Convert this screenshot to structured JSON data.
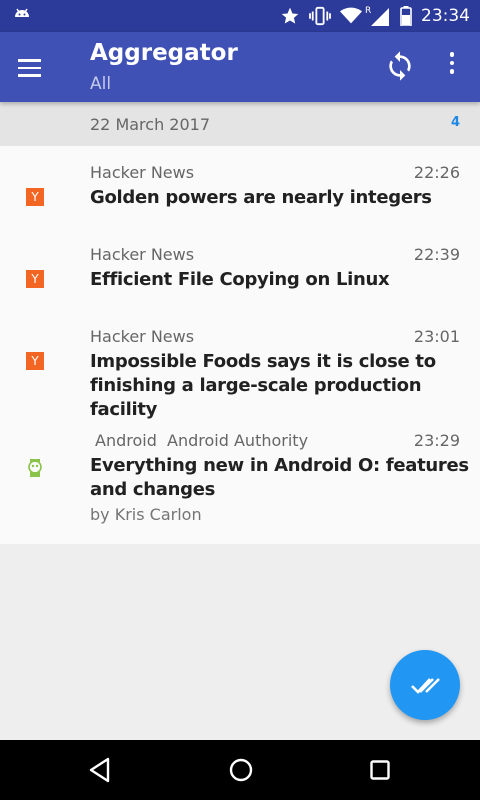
{
  "status_bar": {
    "time": "23:34",
    "icons": [
      "android-icon",
      "star-icon",
      "vibrate-icon",
      "wifi-icon",
      "signal-icon",
      "battery-icon"
    ],
    "signal_label": "R"
  },
  "app_bar": {
    "title": "Aggregator",
    "subtitle": "All",
    "icons": [
      "menu-icon",
      "refresh-icon",
      "overflow-menu-icon"
    ]
  },
  "date_group": {
    "date": "22 March 2017",
    "count": "4"
  },
  "items": [
    {
      "source_icon_letter": "Y",
      "source": "Hacker News",
      "time": "22:26",
      "headline": "Golden powers are nearly integers"
    },
    {
      "source_icon_letter": "Y",
      "source": "Hacker News",
      "time": "22:39",
      "headline": "Efficient File Copying on Linux"
    },
    {
      "source_icon_letter": "Y",
      "source": "Hacker News",
      "time": "23:01",
      "headline": "Impossible Foods says it is close to finishing a large-scale production facility"
    },
    {
      "source": "Android  Android Authority",
      "time": "23:29",
      "headline": "Everything new in Android O: features and changes",
      "author": "by Kris Carlon"
    }
  ],
  "fab": {
    "icon": "mark-all-read-icon"
  },
  "nav_bar": {
    "icons": [
      "back-icon",
      "home-icon",
      "recents-icon"
    ]
  },
  "colors": {
    "status_bar": "#2c3a99",
    "app_bar": "#3f51b5",
    "fab": "#2196f3",
    "hacker_news": "#f26522",
    "count_badge": "#1e88e5"
  }
}
